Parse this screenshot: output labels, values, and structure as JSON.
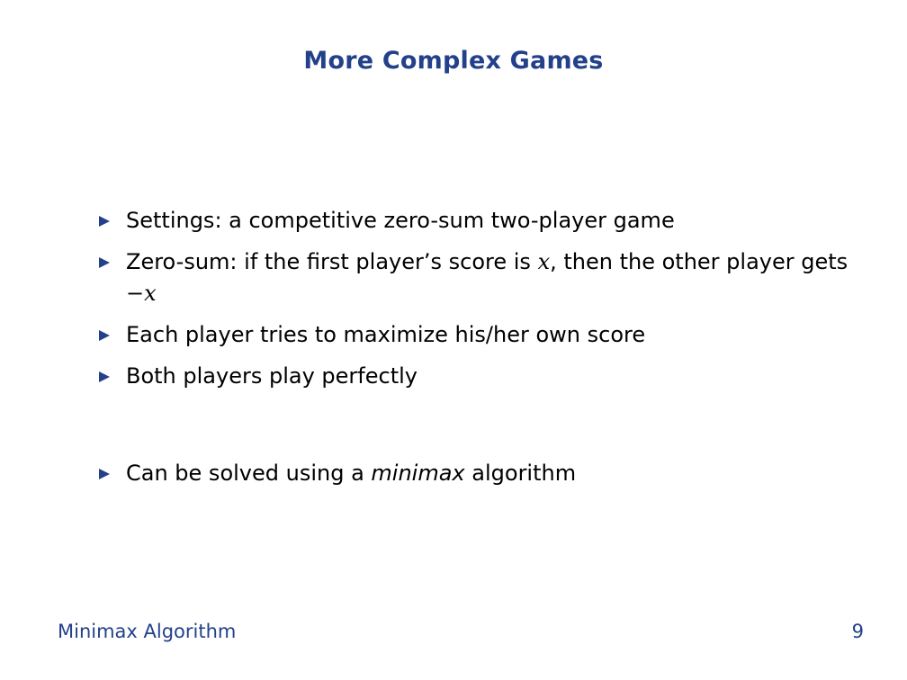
{
  "slide": {
    "title": "More Complex Games",
    "bullets": [
      {
        "text": "Settings: a competitive zero-sum two-player game"
      },
      {
        "part1": "Zero-sum: if the first player’s score is ",
        "var1": "x",
        "part2": ", then the other player gets ",
        "op": "−",
        "var2": "x"
      },
      {
        "text": "Each player tries to maximize his/her own score"
      },
      {
        "text": "Both players play perfectly"
      },
      {
        "before": "Can be solved using a ",
        "emphasis": "minimax",
        "after": " algorithm"
      }
    ]
  },
  "footer": {
    "left": "Minimax Algorithm",
    "page_number": "9"
  },
  "colors": {
    "accent": "#23418a",
    "text": "#000000",
    "background": "#ffffff"
  },
  "icons": {
    "bullet_marker": "triangle-right-icon"
  }
}
